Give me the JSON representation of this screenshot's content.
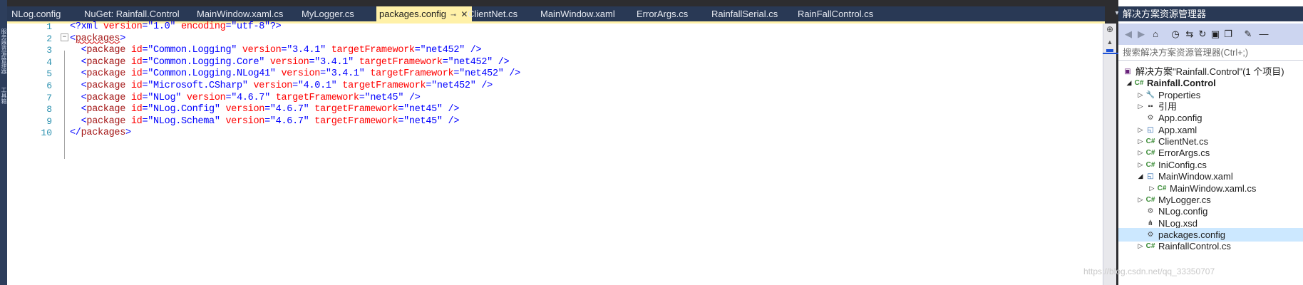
{
  "tabs": [
    {
      "label": "NLog.config"
    },
    {
      "label": "NuGet: Rainfall.Control"
    },
    {
      "label": "MainWindow.xaml.cs"
    },
    {
      "label": "MyLogger.cs"
    },
    {
      "label": "packages.config",
      "active": true
    },
    {
      "label": "ClientNet.cs"
    },
    {
      "label": "MainWindow.xaml"
    },
    {
      "label": "ErrorArgs.cs"
    },
    {
      "label": "RainfallSerial.cs"
    },
    {
      "label": "RainFallControl.cs"
    }
  ],
  "icons": {
    "tab_pin": "⊸",
    "tab_close": "✕",
    "tab_menu": "▾",
    "split": "⊕",
    "scroll_up": "▲",
    "collapse": "−"
  },
  "left_strip": {
    "items": [
      "服务器资源管理器",
      "工具箱"
    ]
  },
  "editor": {
    "line_numbers": [
      "1",
      "2",
      "3",
      "4",
      "5",
      "6",
      "7",
      "8",
      "9",
      "10"
    ],
    "lines": [
      [
        {
          "t": "<?xml ",
          "c": "br"
        },
        {
          "t": "version",
          "c": "at"
        },
        {
          "t": "=\"1.0\" ",
          "c": "av"
        },
        {
          "t": "encoding",
          "c": "at"
        },
        {
          "t": "=\"utf-8\"",
          "c": "av"
        },
        {
          "t": "?>",
          "c": "br"
        }
      ],
      [
        {
          "t": "<",
          "c": "br"
        },
        {
          "t": "packages",
          "c": "tg squig"
        },
        {
          "t": ">",
          "c": "br"
        }
      ],
      [
        {
          "t": "  <",
          "c": "br"
        },
        {
          "t": "package ",
          "c": "tg"
        },
        {
          "t": "id",
          "c": "at"
        },
        {
          "t": "=\"Common.Logging\" ",
          "c": "av"
        },
        {
          "t": "version",
          "c": "at"
        },
        {
          "t": "=\"3.4.1\" ",
          "c": "av"
        },
        {
          "t": "targetFramework",
          "c": "at"
        },
        {
          "t": "=\"net452\" ",
          "c": "av"
        },
        {
          "t": "/>",
          "c": "br"
        }
      ],
      [
        {
          "t": "  <",
          "c": "br"
        },
        {
          "t": "package ",
          "c": "tg"
        },
        {
          "t": "id",
          "c": "at"
        },
        {
          "t": "=\"Common.Logging.Core\" ",
          "c": "av"
        },
        {
          "t": "version",
          "c": "at"
        },
        {
          "t": "=\"3.4.1\" ",
          "c": "av"
        },
        {
          "t": "targetFramework",
          "c": "at"
        },
        {
          "t": "=\"net452\" ",
          "c": "av"
        },
        {
          "t": "/>",
          "c": "br"
        }
      ],
      [
        {
          "t": "  <",
          "c": "br"
        },
        {
          "t": "package ",
          "c": "tg"
        },
        {
          "t": "id",
          "c": "at"
        },
        {
          "t": "=\"Common.Logging.NLog41\" ",
          "c": "av"
        },
        {
          "t": "version",
          "c": "at"
        },
        {
          "t": "=\"3.4.1\" ",
          "c": "av"
        },
        {
          "t": "targetFramework",
          "c": "at"
        },
        {
          "t": "=\"net452\" ",
          "c": "av"
        },
        {
          "t": "/>",
          "c": "br"
        }
      ],
      [
        {
          "t": "  <",
          "c": "br"
        },
        {
          "t": "package ",
          "c": "tg"
        },
        {
          "t": "id",
          "c": "at"
        },
        {
          "t": "=\"Microsoft.CSharp\" ",
          "c": "av"
        },
        {
          "t": "version",
          "c": "at"
        },
        {
          "t": "=\"4.0.1\" ",
          "c": "av"
        },
        {
          "t": "targetFramework",
          "c": "at"
        },
        {
          "t": "=\"net452\" ",
          "c": "av"
        },
        {
          "t": "/>",
          "c": "br"
        }
      ],
      [
        {
          "t": "  <",
          "c": "br"
        },
        {
          "t": "package ",
          "c": "tg"
        },
        {
          "t": "id",
          "c": "at"
        },
        {
          "t": "=\"NLog\" ",
          "c": "av"
        },
        {
          "t": "version",
          "c": "at"
        },
        {
          "t": "=\"4.6.7\" ",
          "c": "av"
        },
        {
          "t": "targetFramework",
          "c": "at"
        },
        {
          "t": "=\"net45\" ",
          "c": "av"
        },
        {
          "t": "/>",
          "c": "br"
        }
      ],
      [
        {
          "t": "  <",
          "c": "br"
        },
        {
          "t": "package ",
          "c": "tg"
        },
        {
          "t": "id",
          "c": "at"
        },
        {
          "t": "=\"NLog.Config\" ",
          "c": "av"
        },
        {
          "t": "version",
          "c": "at"
        },
        {
          "t": "=\"4.6.7\" ",
          "c": "av"
        },
        {
          "t": "targetFramework",
          "c": "at"
        },
        {
          "t": "=\"net45\" ",
          "c": "av"
        },
        {
          "t": "/>",
          "c": "br"
        }
      ],
      [
        {
          "t": "  <",
          "c": "br"
        },
        {
          "t": "package ",
          "c": "tg"
        },
        {
          "t": "id",
          "c": "at"
        },
        {
          "t": "=\"NLog.Schema\" ",
          "c": "av"
        },
        {
          "t": "version",
          "c": "at"
        },
        {
          "t": "=\"4.6.7\" ",
          "c": "av"
        },
        {
          "t": "targetFramework",
          "c": "at"
        },
        {
          "t": "=\"net45\" ",
          "c": "av"
        },
        {
          "t": "/>",
          "c": "br"
        }
      ],
      [
        {
          "t": "</",
          "c": "br"
        },
        {
          "t": "packages",
          "c": "tg"
        },
        {
          "t": ">",
          "c": "br"
        }
      ]
    ]
  },
  "solution_explorer": {
    "title": "解决方案资源管理器",
    "search_placeholder": "搜索解决方案资源管理器(Ctrl+;)",
    "toolbar": [
      {
        "name": "back-icon",
        "glyph": "◀",
        "dim": true
      },
      {
        "name": "forward-icon",
        "glyph": "▶",
        "dim": true
      },
      {
        "name": "home-icon",
        "glyph": "⌂"
      },
      {
        "name": "history-icon",
        "glyph": "◷"
      },
      {
        "name": "sync-icon",
        "glyph": "⇆"
      },
      {
        "name": "refresh-icon",
        "glyph": "↻"
      },
      {
        "name": "collapse-all-icon",
        "glyph": "▣"
      },
      {
        "name": "show-all-files-icon",
        "glyph": "❐"
      },
      {
        "name": "properties-icon",
        "glyph": "✎"
      },
      {
        "name": "preview-icon",
        "glyph": "—"
      }
    ],
    "tree": [
      {
        "label": "解决方案\"Rainfall.Control\"(1 个项目)",
        "indent": 0,
        "arrow": "",
        "icon": "▣",
        "icon_color": "#68217a"
      },
      {
        "label": "Rainfall.Control",
        "indent": 1,
        "arrow": "◢",
        "icon": "C#",
        "icon_color": "#388a34",
        "bold": true
      },
      {
        "label": "Properties",
        "indent": 2,
        "arrow": "▷",
        "icon": "🔧",
        "icon_color": "#444"
      },
      {
        "label": "引用",
        "indent": 2,
        "arrow": "▷",
        "icon": "▪▪",
        "icon_color": "#444"
      },
      {
        "label": "App.config",
        "indent": 2,
        "arrow": "",
        "icon": "⚙",
        "icon_color": "#555"
      },
      {
        "label": "App.xaml",
        "indent": 2,
        "arrow": "▷",
        "icon": "◱",
        "icon_color": "#1e5fa8"
      },
      {
        "label": "ClientNet.cs",
        "indent": 2,
        "arrow": "▷",
        "icon": "C#",
        "icon_color": "#388a34"
      },
      {
        "label": "ErrorArgs.cs",
        "indent": 2,
        "arrow": "▷",
        "icon": "C#",
        "icon_color": "#388a34"
      },
      {
        "label": "IniConfig.cs",
        "indent": 2,
        "arrow": "▷",
        "icon": "C#",
        "icon_color": "#388a34"
      },
      {
        "label": "MainWindow.xaml",
        "indent": 2,
        "arrow": "◢",
        "icon": "◱",
        "icon_color": "#1e5fa8"
      },
      {
        "label": "MainWindow.xaml.cs",
        "indent": 3,
        "arrow": "▷",
        "icon": "C#",
        "icon_color": "#388a34"
      },
      {
        "label": "MyLogger.cs",
        "indent": 2,
        "arrow": "▷",
        "icon": "C#",
        "icon_color": "#388a34"
      },
      {
        "label": "NLog.config",
        "indent": 2,
        "arrow": "",
        "icon": "⚙",
        "icon_color": "#555"
      },
      {
        "label": "NLog.xsd",
        "indent": 2,
        "arrow": "",
        "icon": "⋔",
        "icon_color": "#444"
      },
      {
        "label": "packages.config",
        "indent": 2,
        "arrow": "",
        "icon": "⚙",
        "icon_color": "#555",
        "selected": true
      },
      {
        "label": "RainfallControl.cs",
        "indent": 2,
        "arrow": "▷",
        "icon": "C#",
        "icon_color": "#388a34"
      }
    ]
  },
  "watermark": "https://blog.csdn.net/qq_33350707"
}
